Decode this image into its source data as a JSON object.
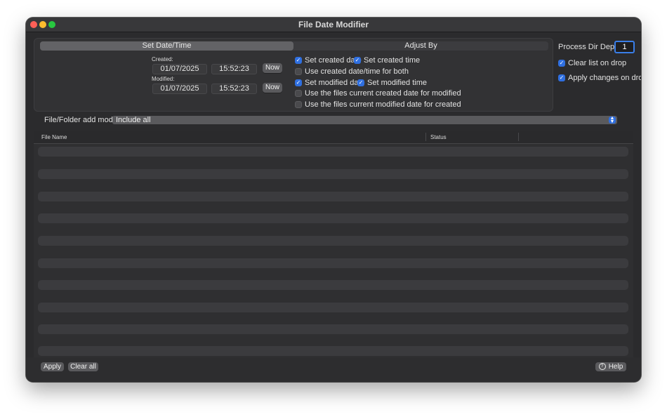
{
  "window": {
    "title": "File Date Modifier"
  },
  "tabs": [
    {
      "label": "Set Date/Time",
      "active": true
    },
    {
      "label": "Adjust By",
      "active": false
    }
  ],
  "created": {
    "label": "Created:",
    "date": "01/07/2025",
    "time": "15:52:23",
    "now_label": "Now"
  },
  "modified": {
    "label": "Modified:",
    "date": "01/07/2025",
    "time": "15:52:23",
    "now_label": "Now"
  },
  "options": {
    "set_created_date": {
      "label": "Set created date",
      "checked": true
    },
    "set_created_time": {
      "label": "Set created time",
      "checked": true
    },
    "use_created_for_both": {
      "label": "Use created date/time for both",
      "checked": false
    },
    "set_modified_date": {
      "label": "Set modified date",
      "checked": true
    },
    "set_modified_time": {
      "label": "Set modified time",
      "checked": true
    },
    "use_created_for_modified": {
      "label": "Use the files current created date for modified",
      "checked": false
    },
    "use_modified_for_created": {
      "label": "Use the files current modified date for created",
      "checked": false
    }
  },
  "right_panel": {
    "depth_label": "Process Dir Depth:",
    "depth_value": "1",
    "clear_list_on_drop": {
      "label": "Clear list on drop",
      "checked": true
    },
    "apply_changes_on_drop": {
      "label": "Apply changes on drop",
      "checked": true
    }
  },
  "add_mode": {
    "label": "File/Folder add mode:",
    "value": "Include all"
  },
  "table": {
    "columns": [
      "File Name",
      "Status"
    ],
    "rows": []
  },
  "footer": {
    "apply_label": "Apply",
    "clear_label": "Clear all",
    "help_label": "Help"
  },
  "colors": {
    "accent": "#2f6fe0",
    "window_bg": "#2b2b2d",
    "button_bg": "#5a5a5d"
  },
  "icons": {
    "checkbox_checked": "checkmark-icon",
    "select_arrow": "updown-chevron-icon",
    "help": "question-circle-icon"
  }
}
